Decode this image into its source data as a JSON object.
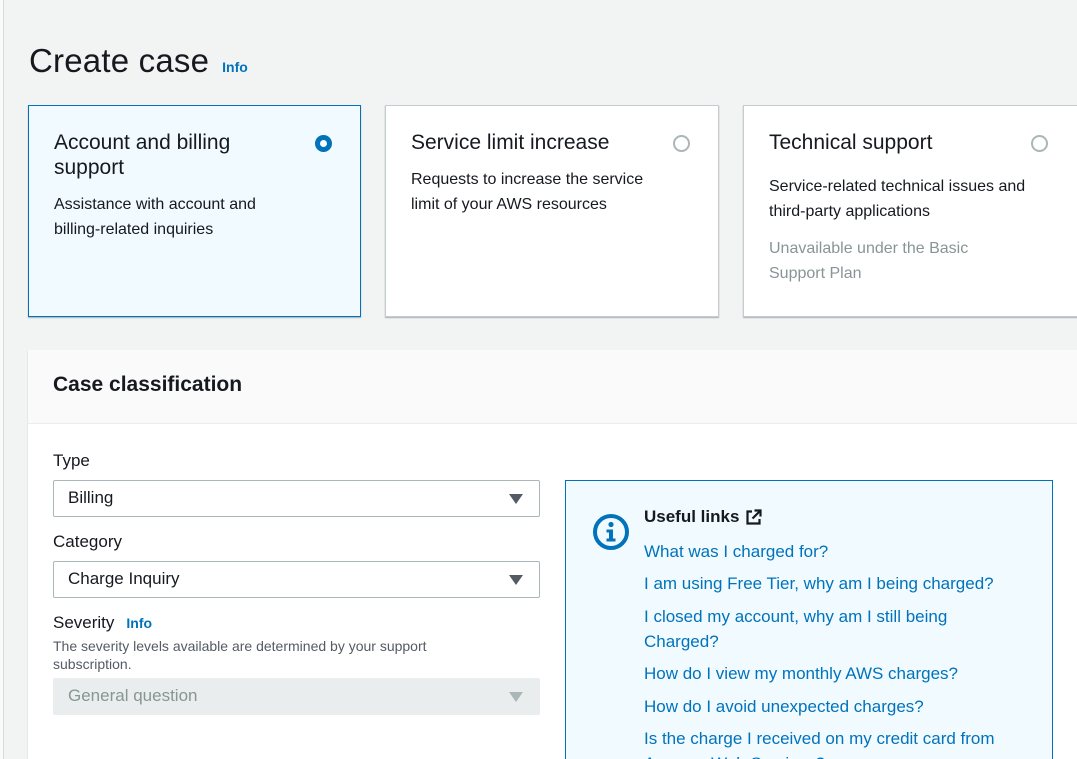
{
  "header": {
    "title": "Create case",
    "info": "Info"
  },
  "tiles": [
    {
      "title": "Account and billing support",
      "desc_lines": [
        "Assistance with account and",
        "billing-related inquiries"
      ],
      "selected": true
    },
    {
      "title": "Service limit increase",
      "desc_lines": [
        "Requests to increase the service",
        "limit of your AWS resources"
      ],
      "selected": false
    },
    {
      "title": "Technical support",
      "desc_lines": [
        "Service-related technical issues and",
        "third-party applications"
      ],
      "note_lines": [
        "Unavailable under the Basic",
        "Support Plan"
      ],
      "selected": false
    }
  ],
  "classification": {
    "title": "Case classification",
    "type": {
      "label": "Type",
      "value": "Billing"
    },
    "category": {
      "label": "Category",
      "value": "Charge Inquiry"
    },
    "severity": {
      "label": "Severity",
      "info": "Info",
      "description": "The severity levels available are determined by your support subscription.",
      "value": "General question"
    }
  },
  "useful_links": {
    "title": "Useful links",
    "links": [
      "What was I charged for?",
      "I am using Free Tier, why am I being charged?",
      "I closed my account, why am I still being Charged?",
      "How do I view my monthly AWS charges?",
      "How do I avoid unexpected charges?",
      "Is the charge I received on my credit card from Amazon Web Services?"
    ]
  },
  "colors": {
    "accent": "#0073bb",
    "muted": "#879596",
    "selected_bg": "#f1faff"
  }
}
